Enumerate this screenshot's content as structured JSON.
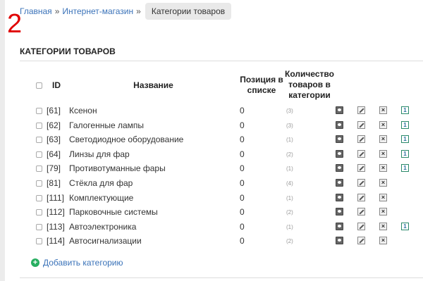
{
  "breadcrumb": {
    "home": "Главная",
    "sep": "»",
    "store": "Интернет-магазин",
    "current": "Категории товаров"
  },
  "annotation": "2",
  "section_title": "КАТЕГОРИИ ТОВАРОВ",
  "table": {
    "headers": {
      "id": "ID",
      "name": "Название",
      "position_line1": "Позиция в",
      "position_line2": "списке",
      "count_line1": "Количество",
      "count_line2": "товаров в",
      "count_line3": "категории"
    },
    "rows": [
      {
        "id": "[61]",
        "name": "Ксенон",
        "position": "0",
        "count": "(3)",
        "has_sub": true
      },
      {
        "id": "[62]",
        "name": "Галогенные лампы",
        "position": "0",
        "count": "(3)",
        "has_sub": true
      },
      {
        "id": "[63]",
        "name": "Светодиодное оборудование",
        "position": "0",
        "count": "(1)",
        "has_sub": true
      },
      {
        "id": "[64]",
        "name": "Линзы для фар",
        "position": "0",
        "count": "(2)",
        "has_sub": true
      },
      {
        "id": "[79]",
        "name": "Противотуманные фары",
        "position": "0",
        "count": "(1)",
        "has_sub": true
      },
      {
        "id": "[81]",
        "name": "Стёкла для фар",
        "position": "0",
        "count": "(4)",
        "has_sub": false
      },
      {
        "id": "[111]",
        "name": "Комплектующие",
        "position": "0",
        "count": "(1)",
        "has_sub": false
      },
      {
        "id": "[112]",
        "name": "Парковочные системы",
        "position": "0",
        "count": "(2)",
        "has_sub": false
      },
      {
        "id": "[113]",
        "name": "Автоэлектроника",
        "position": "0",
        "count": "(1)",
        "has_sub": true
      },
      {
        "id": "[114]",
        "name": "Автосигнализации",
        "position": "0",
        "count": "(2)",
        "has_sub": false
      }
    ]
  },
  "add_category_label": "Добавить категорию",
  "icons": {
    "view": "view-icon",
    "edit": "edit-icon",
    "delete": "delete-icon",
    "subcategory": "subcategory-icon"
  }
}
